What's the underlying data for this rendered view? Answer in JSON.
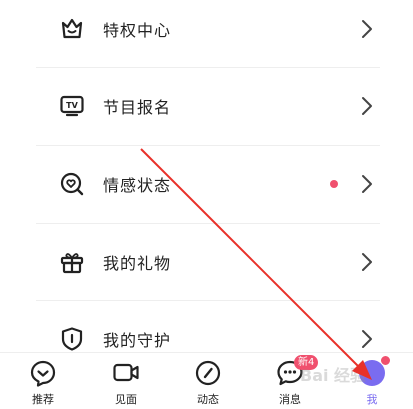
{
  "menu": {
    "items": [
      {
        "label": "特权中心",
        "icon": "crown-icon",
        "has_dot": false
      },
      {
        "label": "节目报名",
        "icon": "tv-icon",
        "has_dot": false
      },
      {
        "label": "情感状态",
        "icon": "heart-search-icon",
        "has_dot": true
      },
      {
        "label": "我的礼物",
        "icon": "gift-icon",
        "has_dot": false
      },
      {
        "label": "我的守护",
        "icon": "shield-icon",
        "has_dot": false
      }
    ]
  },
  "tabbar": {
    "tabs": [
      {
        "label": "推荐",
        "icon": "recommend-icon",
        "active": false
      },
      {
        "label": "见面",
        "icon": "video-icon",
        "active": false
      },
      {
        "label": "动态",
        "icon": "compass-icon",
        "active": false
      },
      {
        "label": "消息",
        "icon": "message-icon",
        "active": false
      },
      {
        "label": "我",
        "icon": "avatar",
        "active": true
      }
    ],
    "message_badge": "新4"
  },
  "watermark": "Bai 经验",
  "colors": {
    "accent": "#7a6cf0",
    "dot": "#f0506e",
    "annotation_arrow": "#e8312a"
  }
}
